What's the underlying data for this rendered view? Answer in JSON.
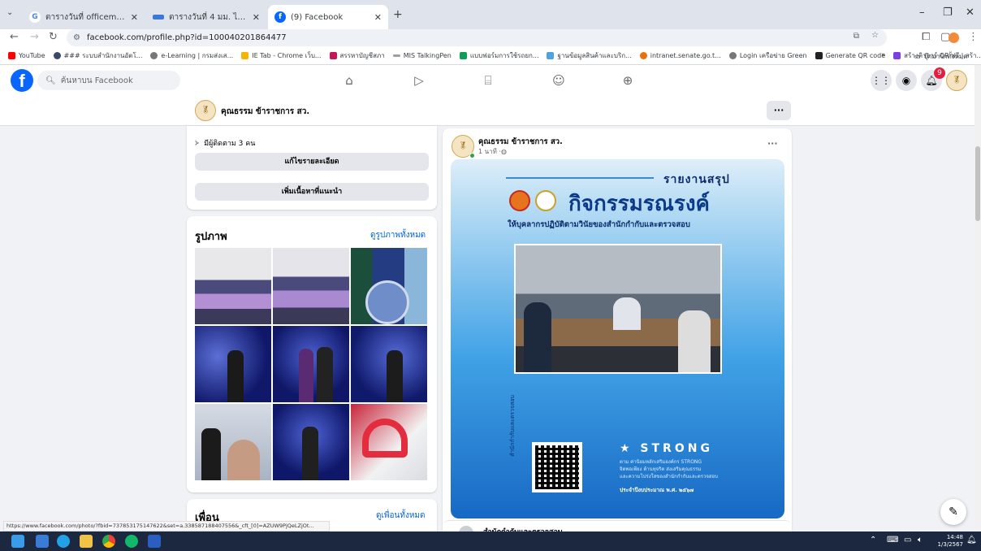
{
  "browser": {
    "tabs": [
      {
        "title": "ตารางวันที่ officemate 2567 - ต",
        "active": false
      },
      {
        "title": "ตารางวันที่ 4 มม. ไทม ไพลิด TR-",
        "active": false
      },
      {
        "title": "(9) Facebook",
        "active": true
      }
    ],
    "new_tab_glyph": "+",
    "url": "facebook.com/profile.php?id=100040201864477",
    "bookmarks": [
      "YouTube",
      "### ระบบสำนักงานอัตโ...",
      "e-Learning | กรมส่งเส...",
      "IE Tab - Chrome เว็บ...",
      "สรรหาบัญชีสภา",
      "MIS TalkingPen",
      "แบบฟอร์มการใช้รถยก...",
      "ฐานข้อมูลสินค้าและบริก...",
      "intranet.senate.go.t...",
      "Login เครือข่าย Green",
      "Generate QR code",
      "สร้างคิวอาร์ QR ฟรี | สร้า..."
    ],
    "bookmarks_more": "»",
    "bookmarks_folder": "บุ๊กมาร์กทั้งหมด",
    "accent": "#0866ff"
  },
  "fb": {
    "search_placeholder": "ค้นหาบน Facebook",
    "notification_count": "9",
    "profile_name": "คุณธรรม ข้าราชการ สว.",
    "more_glyph": "···",
    "followers": "มีผู้ติดตาม 3 คน",
    "edit_details": "แก้ไขรายละเอียด",
    "add_featured": "เพิ่มเนื้อหาที่แนะนำ",
    "photos_title": "รูปภาพ",
    "see_all_photos": "ดูรูปภาพทั้งหมด",
    "friends_title": "เพื่อน",
    "see_all_friends": "ดูเพื่อนทั้งหมด"
  },
  "post": {
    "author": "คุณธรรม ข้าราชการ สว.",
    "time": "1 นาที · ",
    "poster": {
      "kicker": "รายงานสรุป",
      "headline": "กิจกรรมรณรงค์",
      "subtitle": "ให้บุคลากรปฏิบัติตามวินัยของสำนักกำกับและตรวจสอบ",
      "vertical_text": "สำนักกำกับและตรวจสอบ",
      "strong_title": "★ STRONG",
      "strong_lines": [
        "ตาม ค่านิยมหลักเสริมองค์กร STRONG",
        "จิตพอเพียง ต้านทุจริต ส่งเสริมคุณธรรม",
        "และความโปร่งใสของสำนักกำกับและตรวจสอบ"
      ],
      "fiscal_year": "ประจำปีงบประมาณ พ.ศ. ๒๕๖๗"
    },
    "next_post_author": "สำนักกำกับและตรวจสอบ"
  },
  "status_url": "https://www.facebook.com/photo/?fbid=737853175147622&set=a.338587188407556&_cft_[0]=AZUW9PjQeLZjOt...",
  "taskbar": {
    "time": "14:48",
    "date": "1/3/2567"
  }
}
